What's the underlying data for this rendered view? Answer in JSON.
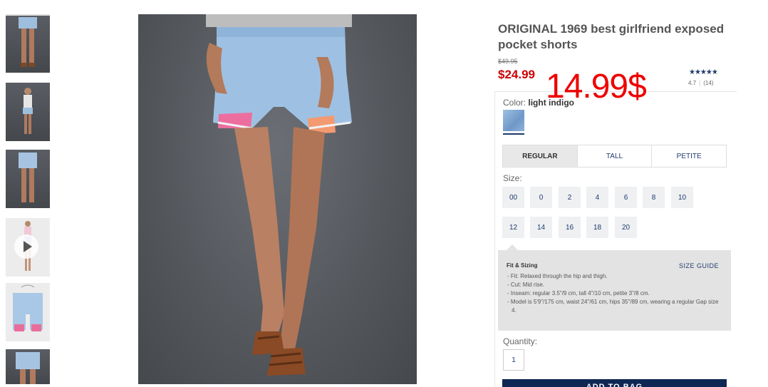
{
  "product": {
    "title": "ORIGINAL 1969 best girlfriend exposed pocket shorts",
    "original_price": "$49.95",
    "sale_price": "$24.99",
    "overlay_price": "14.99$",
    "stars": "★★★★★",
    "rating_value": "4.7",
    "rating_separator": "|",
    "review_count": "(14)",
    "rating_fraction": 0.94
  },
  "color": {
    "label": "Color:",
    "value": "light indigo"
  },
  "fit_tabs": [
    {
      "label": "REGULAR",
      "active": true
    },
    {
      "label": "TALL",
      "active": false
    },
    {
      "label": "PETITE",
      "active": false
    }
  ],
  "size": {
    "label": "Size:",
    "options": [
      "00",
      "0",
      "2",
      "4",
      "6",
      "8",
      "10",
      "12",
      "14",
      "16",
      "18",
      "20"
    ]
  },
  "fit_sizing": {
    "title": "Fit & Sizing",
    "guide_link": "SIZE GUIDE",
    "lines": [
      "- Fit: Relaxed through the hip and thigh.",
      "- Cut: Mid rise.",
      "- Inseam: regular 3.5\"/9 cm, tall 4\"/10 cm, petite 3\"/8 cm.",
      "- Model is 5'9\"/175 cm, waist 24\"/61 cm, hips 35\"/89 cm, wearing a regular Gap size 4."
    ]
  },
  "quantity": {
    "label": "Quantity:",
    "value": "1"
  },
  "add_to_bag": "ADD TO BAG",
  "colors": {
    "brand_navy": "#0f2753",
    "sale_red": "#cc0000",
    "overlay_red": "#ee0000",
    "link_blue": "#1f3b6d"
  },
  "icons": {
    "video_thumb": "play-icon"
  }
}
